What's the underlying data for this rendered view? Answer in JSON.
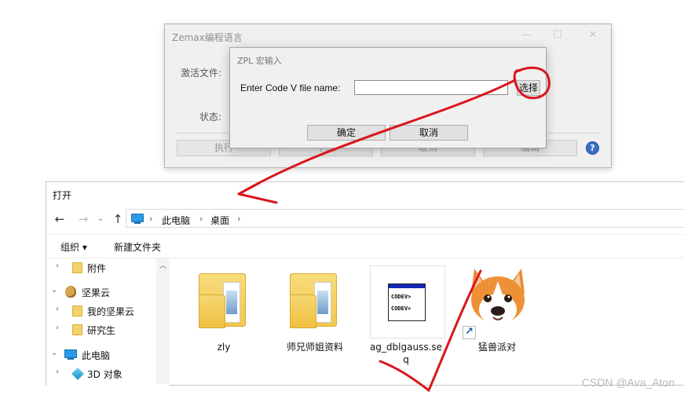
{
  "zemax": {
    "title": "Zemax编程语言",
    "active_file_label": "激活文件:",
    "status_label": "状态:",
    "buttons": [
      "执行",
      "中止",
      "取消",
      "编辑"
    ],
    "help_icon": "?"
  },
  "zpl_dialog": {
    "title": "ZPL 宏输入",
    "prompt": "Enter Code V file name:",
    "field_value": "",
    "browse_label": "选择",
    "ok_label": "确定",
    "cancel_label": "取消"
  },
  "open_dialog": {
    "title": "打开",
    "breadcrumb": [
      "此电脑",
      "桌面"
    ],
    "toolbar": {
      "organize": "组织 ▾",
      "new_folder": "新建文件夹"
    },
    "nav_items": [
      {
        "label": "附件",
        "icon": "folder-icon",
        "expander": "›"
      },
      {
        "label": "坚果云",
        "icon": "nut-icon",
        "expander": "⌄"
      },
      {
        "label": "我的坚果云",
        "icon": "folder-icon",
        "expander": "›"
      },
      {
        "label": "研究生",
        "icon": "folder-icon",
        "expander": "›"
      },
      {
        "label": "此电脑",
        "icon": "pc-icon",
        "expander": "⌄"
      },
      {
        "label": "3D 对象",
        "icon": "cube-icon",
        "expander": "›"
      }
    ],
    "files": [
      {
        "name": "zly",
        "icon": "folder-icon"
      },
      {
        "name": "师兄师姐资料",
        "icon": "folder-icon"
      },
      {
        "name_line1": "ag_dblgauss.se",
        "name_line2": "q",
        "icon": "codev-file-icon"
      },
      {
        "name": "猛兽派对",
        "icon": "dog-shortcut-icon"
      }
    ]
  },
  "annotation_color": "#d9161c",
  "watermark": "CSDN @Ava_Aton"
}
